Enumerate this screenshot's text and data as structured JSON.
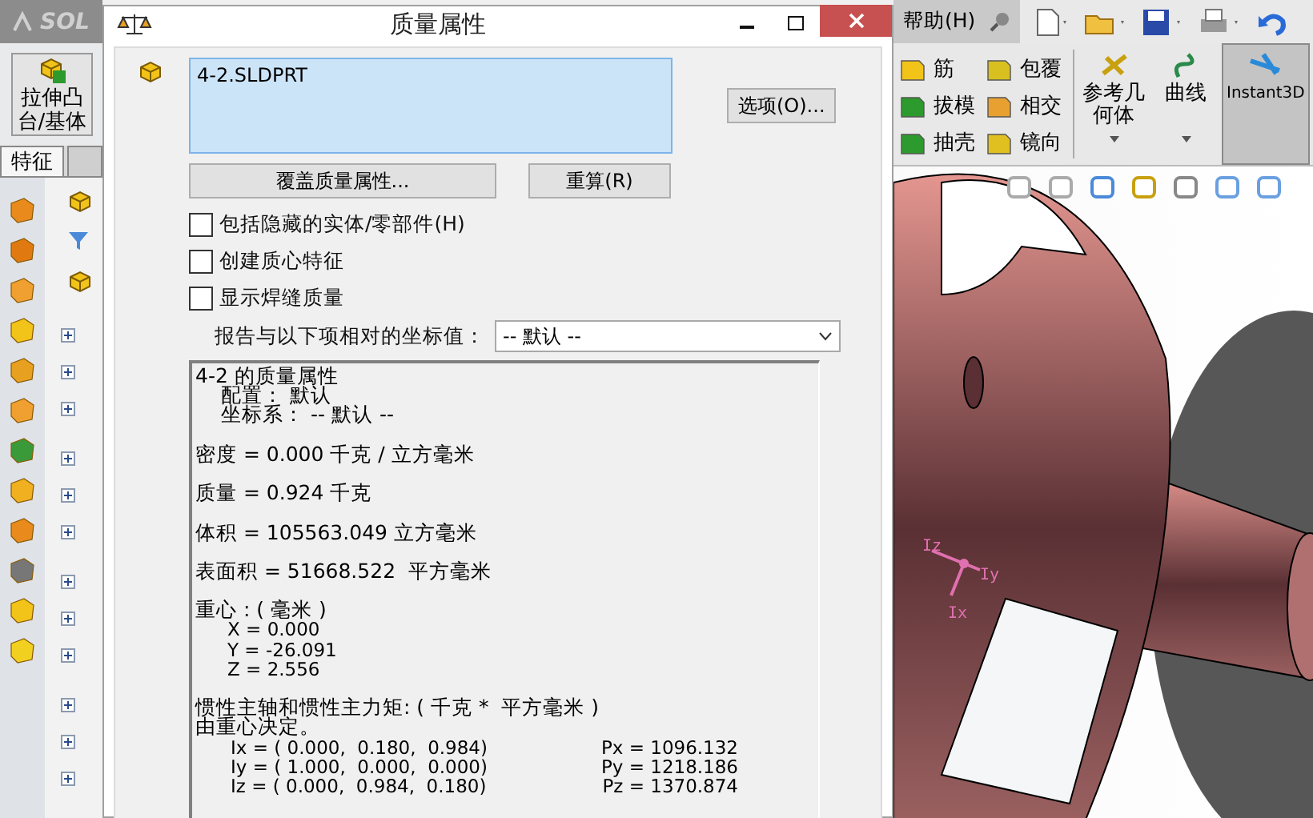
{
  "app": {
    "logo": "SOL",
    "help_menu": "帮助(H)"
  },
  "left_panel": {
    "feature_button": "拉伸凸台/基体",
    "tabs": [
      {
        "label": "特征",
        "selected": true
      }
    ]
  },
  "dialog": {
    "title": "质量属性",
    "selection": "4-2.SLDPRT",
    "options_button": "选项(O)...",
    "override_button": "覆盖质量属性...",
    "recalc_button": "重算(R)",
    "checkboxes": [
      {
        "label": "包括隐藏的实体/零部件(H)",
        "checked": false
      },
      {
        "label": "创建质心特征",
        "checked": false
      },
      {
        "label": "显示焊缝质量",
        "checked": false
      }
    ],
    "coordinate_label": "报告与以下项相对的坐标值：",
    "coordinate_value": "-- 默认 --",
    "results": [
      {
        "kind": "title",
        "text": "4-2 的质量属性"
      },
      {
        "kind": "sub",
        "text": "配置： 默认"
      },
      {
        "kind": "sub",
        "text": "坐标系： -- 默认 --"
      },
      {
        "kind": "gap"
      },
      {
        "kind": "line",
        "text": "密度 = 0.000 千克 / 立方毫米"
      },
      {
        "kind": "gap"
      },
      {
        "kind": "line",
        "text": "质量 = 0.924 千克"
      },
      {
        "kind": "gap"
      },
      {
        "kind": "line",
        "text": "体积 = 105563.049 立方毫米"
      },
      {
        "kind": "gap"
      },
      {
        "kind": "line",
        "text": "表面积 = 51668.522  平方毫米"
      },
      {
        "kind": "gap"
      },
      {
        "kind": "line",
        "text": "重心 : ( 毫米 )"
      },
      {
        "kind": "coord",
        "text": "X = 0.000"
      },
      {
        "kind": "coord",
        "text": "Y = -26.091"
      },
      {
        "kind": "coord",
        "text": "Z = 2.556"
      },
      {
        "kind": "gap"
      },
      {
        "kind": "line",
        "text": "惯性主轴和惯性主力矩: ( 千克 *  平方毫米 )"
      },
      {
        "kind": "line",
        "text": "由重心决定。"
      },
      {
        "kind": "axis",
        "text": "Ix = ( 0.000,  0.180,  0.984)",
        "moment": "Px = 1096.132"
      },
      {
        "kind": "axis",
        "text": "Iy = ( 1.000,  0.000,  0.000)",
        "moment": "Py = 1218.186"
      },
      {
        "kind": "axis",
        "text": "Iz = ( 0.000,  0.984,  0.180)",
        "moment": "Pz = 1370.874"
      }
    ]
  },
  "ribbon": {
    "small_tools": [
      "筋",
      "拔模",
      "抽壳",
      "包覆",
      "相交",
      "镜向"
    ],
    "big_tools": [
      {
        "label": "参考几何体",
        "selected": false,
        "dropdown": true
      },
      {
        "label": "曲线",
        "selected": false,
        "dropdown": true
      },
      {
        "label": "Instant3D",
        "selected": true,
        "dropdown": false
      }
    ]
  },
  "viewport": {
    "triad_labels": [
      "Iz",
      "Iy",
      "Ix"
    ]
  }
}
